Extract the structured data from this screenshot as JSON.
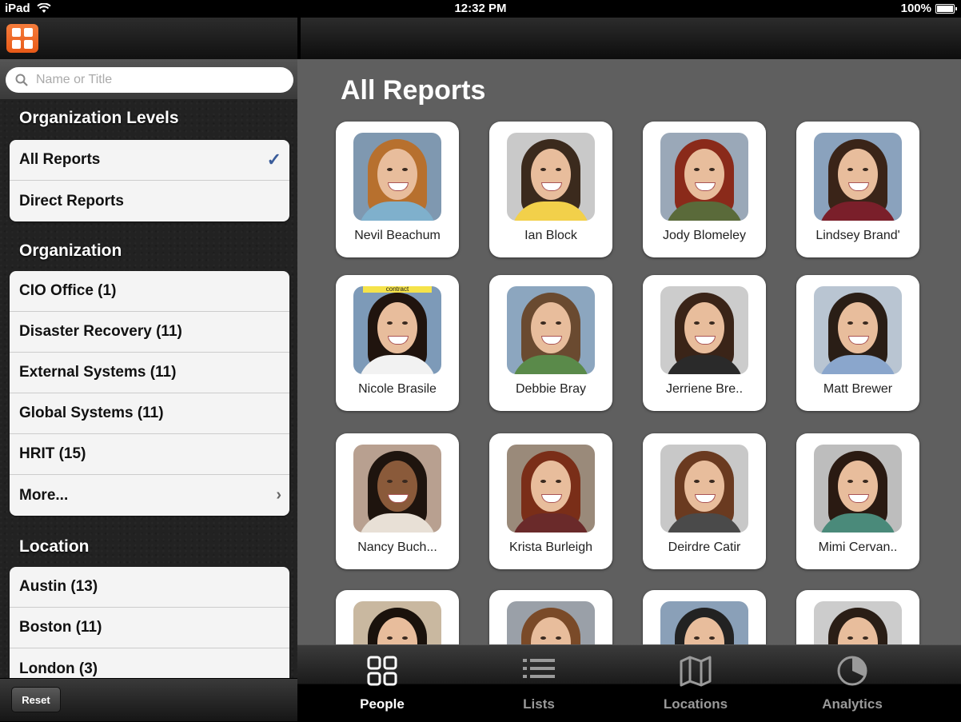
{
  "status_bar": {
    "carrier": "iPad",
    "time": "12:32 PM",
    "battery": "100%"
  },
  "sidebar": {
    "search_placeholder": "Name or Title",
    "sections": {
      "org_levels": {
        "title": "Organization Levels",
        "items": [
          {
            "label": "All Reports",
            "selected": true
          },
          {
            "label": "Direct Reports"
          }
        ]
      },
      "organization": {
        "title": "Organization",
        "items": [
          {
            "label": "CIO Office (1)"
          },
          {
            "label": "Disaster Recovery (11)"
          },
          {
            "label": "External Systems (11)"
          },
          {
            "label": "Global Systems (11)"
          },
          {
            "label": "HRIT (15)"
          },
          {
            "label": "More..."
          }
        ]
      },
      "location": {
        "title": "Location",
        "items": [
          {
            "label": "Austin (13)"
          },
          {
            "label": "Boston (11)"
          },
          {
            "label": "London (3)"
          }
        ]
      }
    },
    "reset_label": "Reset"
  },
  "main": {
    "title": "All Reports",
    "people": [
      {
        "name": "Nevil Beachum",
        "hair": "#b7702e",
        "shirt": "#7fb0cc",
        "bg": "#7f98b0"
      },
      {
        "name": "Ian Block",
        "hair": "#3b2a1d",
        "shirt": "#f2d04a",
        "bg": "#c9c9c9"
      },
      {
        "name": "Jody Blomeley",
        "hair": "#8a2a1a",
        "shirt": "#5a6a3a",
        "bg": "#9aa8b8"
      },
      {
        "name": "Lindsey Brand'",
        "hair": "#3a2418",
        "shirt": "#7a1f2a",
        "bg": "#8aa2bd"
      },
      {
        "name": "Nicole Brasile",
        "hair": "#20140e",
        "shirt": "#f2f2f2",
        "bg": "#7d9ab8",
        "tag": "contract"
      },
      {
        "name": "Debbie Bray",
        "hair": "#6a4a30",
        "shirt": "#5a8a4a",
        "bg": "#8ca6bf"
      },
      {
        "name": "Jerriene Bre..",
        "hair": "#3a2418",
        "shirt": "#2a2a2a",
        "bg": "#cccccc"
      },
      {
        "name": "Matt Brewer",
        "hair": "#2a1e16",
        "shirt": "#8aa6cc",
        "bg": "#b9c5d2"
      },
      {
        "name": "Nancy Buch...",
        "hair": "#1e140e",
        "shirt": "#e8e0d6",
        "bg": "#b8a090",
        "skin": "#8a5a3a"
      },
      {
        "name": "Krista Burleigh",
        "hair": "#7a2e18",
        "shirt": "#6a2a2a",
        "bg": "#9a8a7a"
      },
      {
        "name": "Deirdre Catir",
        "hair": "#6a3a20",
        "shirt": "#4a4a4a",
        "bg": "#c8c8c8"
      },
      {
        "name": "Mimi Cervan..",
        "hair": "#2a1a12",
        "shirt": "#4a8a7a",
        "bg": "#bdbdbd"
      },
      {
        "name": "",
        "hair": "#1a120c",
        "shirt": "#5a4a3a",
        "bg": "#c9b8a0"
      },
      {
        "name": "",
        "hair": "#7a4a28",
        "shirt": "#6a5a4a",
        "bg": "#9aa0a8"
      },
      {
        "name": "",
        "hair": "#222222",
        "shirt": "#4a5a6a",
        "bg": "#8aa0b8"
      },
      {
        "name": "",
        "hair": "#2a1e16",
        "shirt": "#6a6a6a",
        "bg": "#cccccc"
      }
    ]
  },
  "tabs": [
    {
      "label": "People",
      "icon": "grid-icon",
      "active": true
    },
    {
      "label": "Lists",
      "icon": "list-icon"
    },
    {
      "label": "Locations",
      "icon": "map-icon"
    },
    {
      "label": "Analytics",
      "icon": "pie-chart-icon"
    }
  ]
}
